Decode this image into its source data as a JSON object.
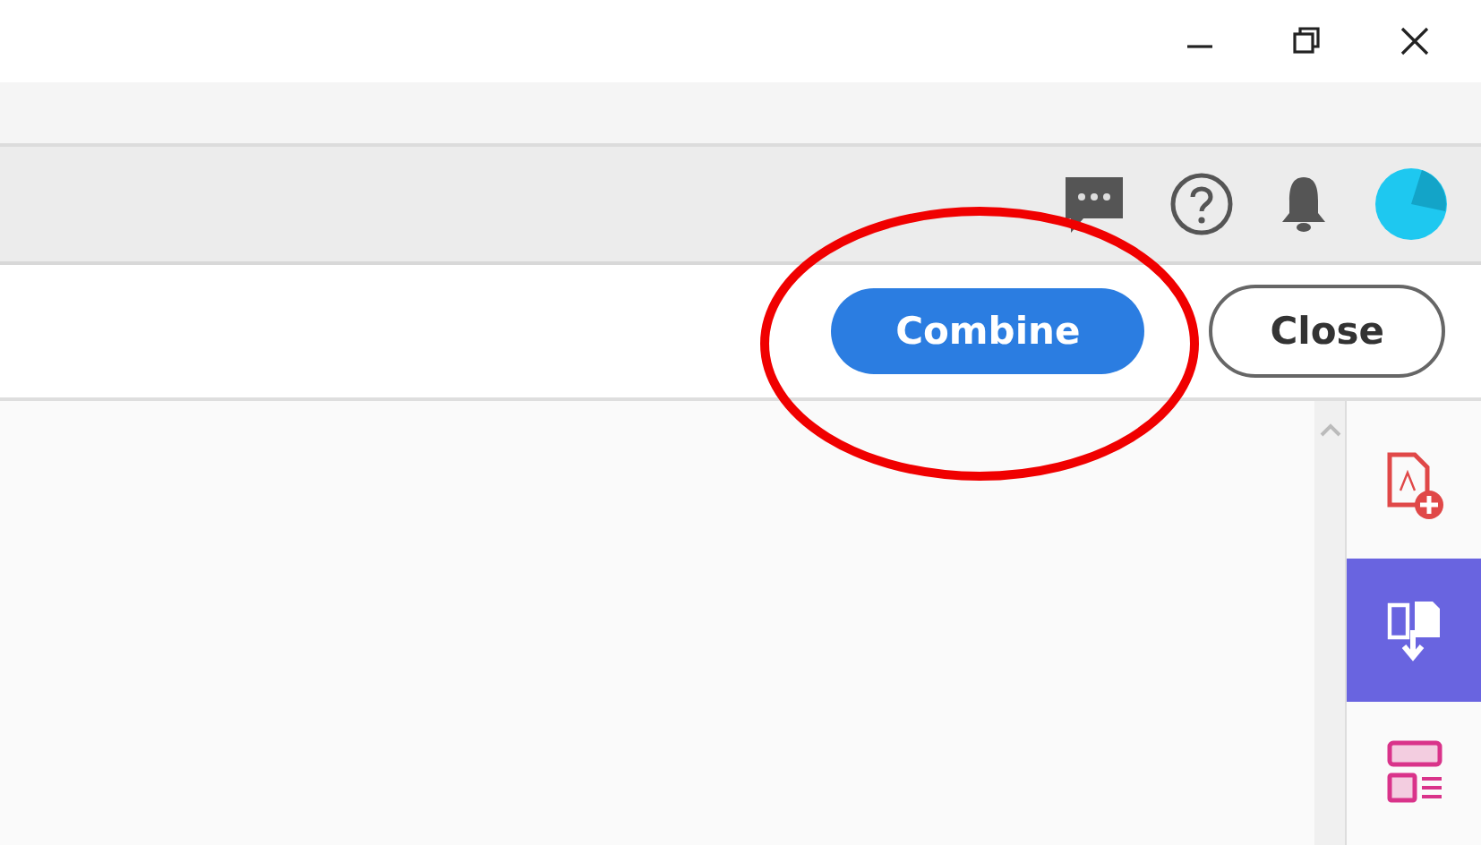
{
  "window": {
    "controls": [
      {
        "kind": "minimize"
      },
      {
        "kind": "restore"
      },
      {
        "kind": "close"
      }
    ]
  },
  "toolbar": {
    "icons": [
      {
        "kind": "chat"
      },
      {
        "kind": "help"
      },
      {
        "kind": "bell"
      },
      {
        "kind": "avatar"
      }
    ]
  },
  "actions": {
    "buttons": [
      {
        "label": "Combine",
        "kind": "primary"
      },
      {
        "label": "Close",
        "kind": "secondary"
      }
    ]
  },
  "tools": [
    {
      "kind": "create-pdf",
      "selected": false
    },
    {
      "kind": "export-pdf",
      "selected": true
    },
    {
      "kind": "organize",
      "selected": false
    }
  ],
  "annotation": {
    "kind": "ellipse"
  }
}
